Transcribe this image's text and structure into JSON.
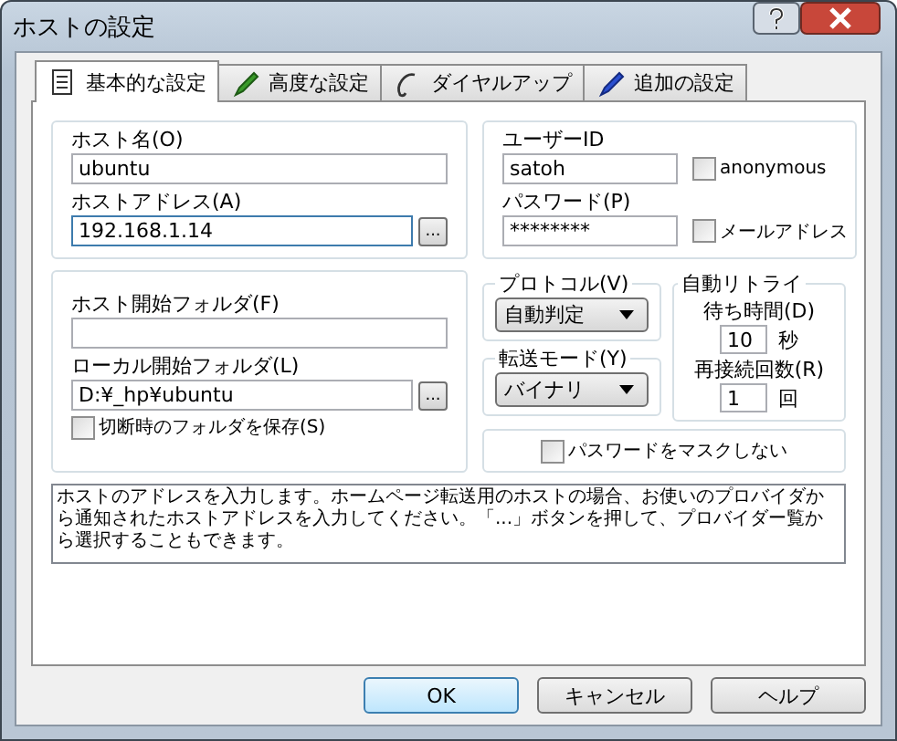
{
  "window": {
    "title": "ホストの設定"
  },
  "tabs": [
    {
      "label": "基本的な設定",
      "selected": true
    },
    {
      "label": "高度な設定",
      "selected": false
    },
    {
      "label": "ダイヤルアップ",
      "selected": false
    },
    {
      "label": "追加の設定",
      "selected": false
    }
  ],
  "host_name": {
    "label": "ホスト名(O)",
    "value": "ubuntu"
  },
  "host_address": {
    "label": "ホストアドレス(A)",
    "value": "192.168.1.14",
    "focused": true,
    "browse": "..."
  },
  "user_id": {
    "label": "ユーザーID",
    "value": "satoh",
    "checkbox": {
      "label": "anonymous",
      "checked": false
    }
  },
  "password": {
    "label": "パスワード(P)",
    "value": "********",
    "checkbox": {
      "label": "メールアドレス",
      "checked": false
    }
  },
  "host_start_folder": {
    "label": "ホスト開始フォルダ(F)"
  },
  "local_start_folder": {
    "label": "ローカル開始フォルダ(L)",
    "value": "D:¥_hp¥ubuntu",
    "browse": "..."
  },
  "save_folder_on_disconnect": {
    "label": "切断時のフォルダを保存(S)",
    "checked": false
  },
  "protocol": {
    "title": "プロトコル(V)",
    "value": "自動判定"
  },
  "transfer_mode": {
    "title": "転送モード(Y)",
    "value": "バイナリ"
  },
  "auto_retry": {
    "title": "自動リトライ",
    "wait_label": "待ち時間(D)",
    "wait_value": "10",
    "wait_unit": "秒",
    "retry_label": "再接続回数(R)",
    "retry_value": "1",
    "retry_unit": "回"
  },
  "unmask_password": {
    "label": "パスワードをマスクしない",
    "checked": false
  },
  "description": "ホストのアドレスを入力します。ホームページ転送用のホストの場合、お使いのプロバイダから通知されたホストアドレスを入力してください。「...」ボタンを押して、プロバイダー覧から選択することもできます。",
  "buttons": [
    {
      "label": "OK",
      "default": true
    },
    {
      "label": "キャンセル",
      "default": false
    },
    {
      "label": "ヘルプ",
      "default": false
    }
  ]
}
